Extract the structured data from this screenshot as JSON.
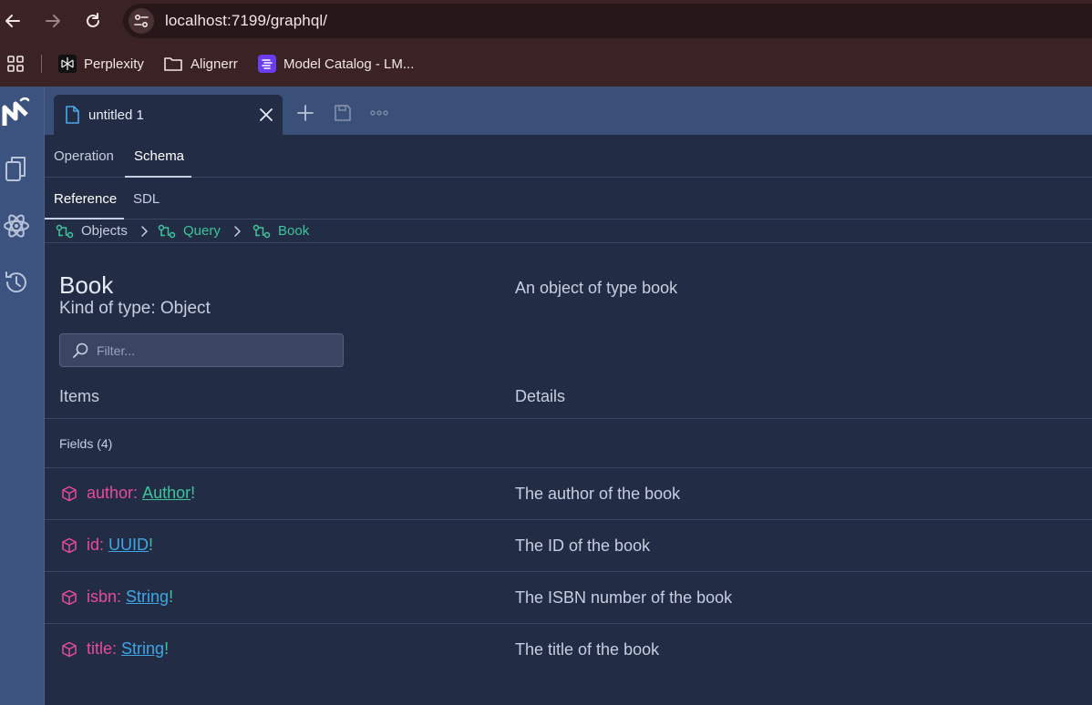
{
  "browser": {
    "url": "localhost:7199/graphql/",
    "bookmarks": [
      {
        "label": "Perplexity",
        "icon": "perplexity-icon"
      },
      {
        "label": "Alignerr",
        "icon": "folder-icon"
      },
      {
        "label": "Model Catalog - LM...",
        "icon": "lmstudio-icon"
      }
    ]
  },
  "app": {
    "document_tab": "untitled 1",
    "top_tabs": [
      "Operation",
      "Schema"
    ],
    "active_top_tab": "Schema",
    "sub_tabs": [
      "Reference",
      "SDL"
    ],
    "active_sub_tab": "Reference",
    "breadcrumb": [
      "Objects",
      "Query",
      "Book"
    ]
  },
  "type": {
    "name": "Book",
    "kind": "Kind of type: Object",
    "description": "An object of type book"
  },
  "filter": {
    "placeholder": "Filter..."
  },
  "columns": {
    "items": "Items",
    "details": "Details"
  },
  "fields_group": "Fields (4)",
  "fields": [
    {
      "name": "author",
      "type": "Author",
      "type_kind": "object",
      "description": "The author of the book"
    },
    {
      "name": "id",
      "type": "UUID",
      "type_kind": "scalar",
      "description": "The ID of the book"
    },
    {
      "name": "isbn",
      "type": "String",
      "type_kind": "scalar",
      "description": "The ISBN number of the book"
    },
    {
      "name": "title",
      "type": "String",
      "type_kind": "scalar",
      "description": "The title of the book"
    }
  ],
  "colors": {
    "field_name": "#e84c97",
    "object_type": "#3dc49a",
    "scalar_type": "#3fa6e6",
    "background": "#222d45",
    "sidebar": "#3c5380"
  }
}
